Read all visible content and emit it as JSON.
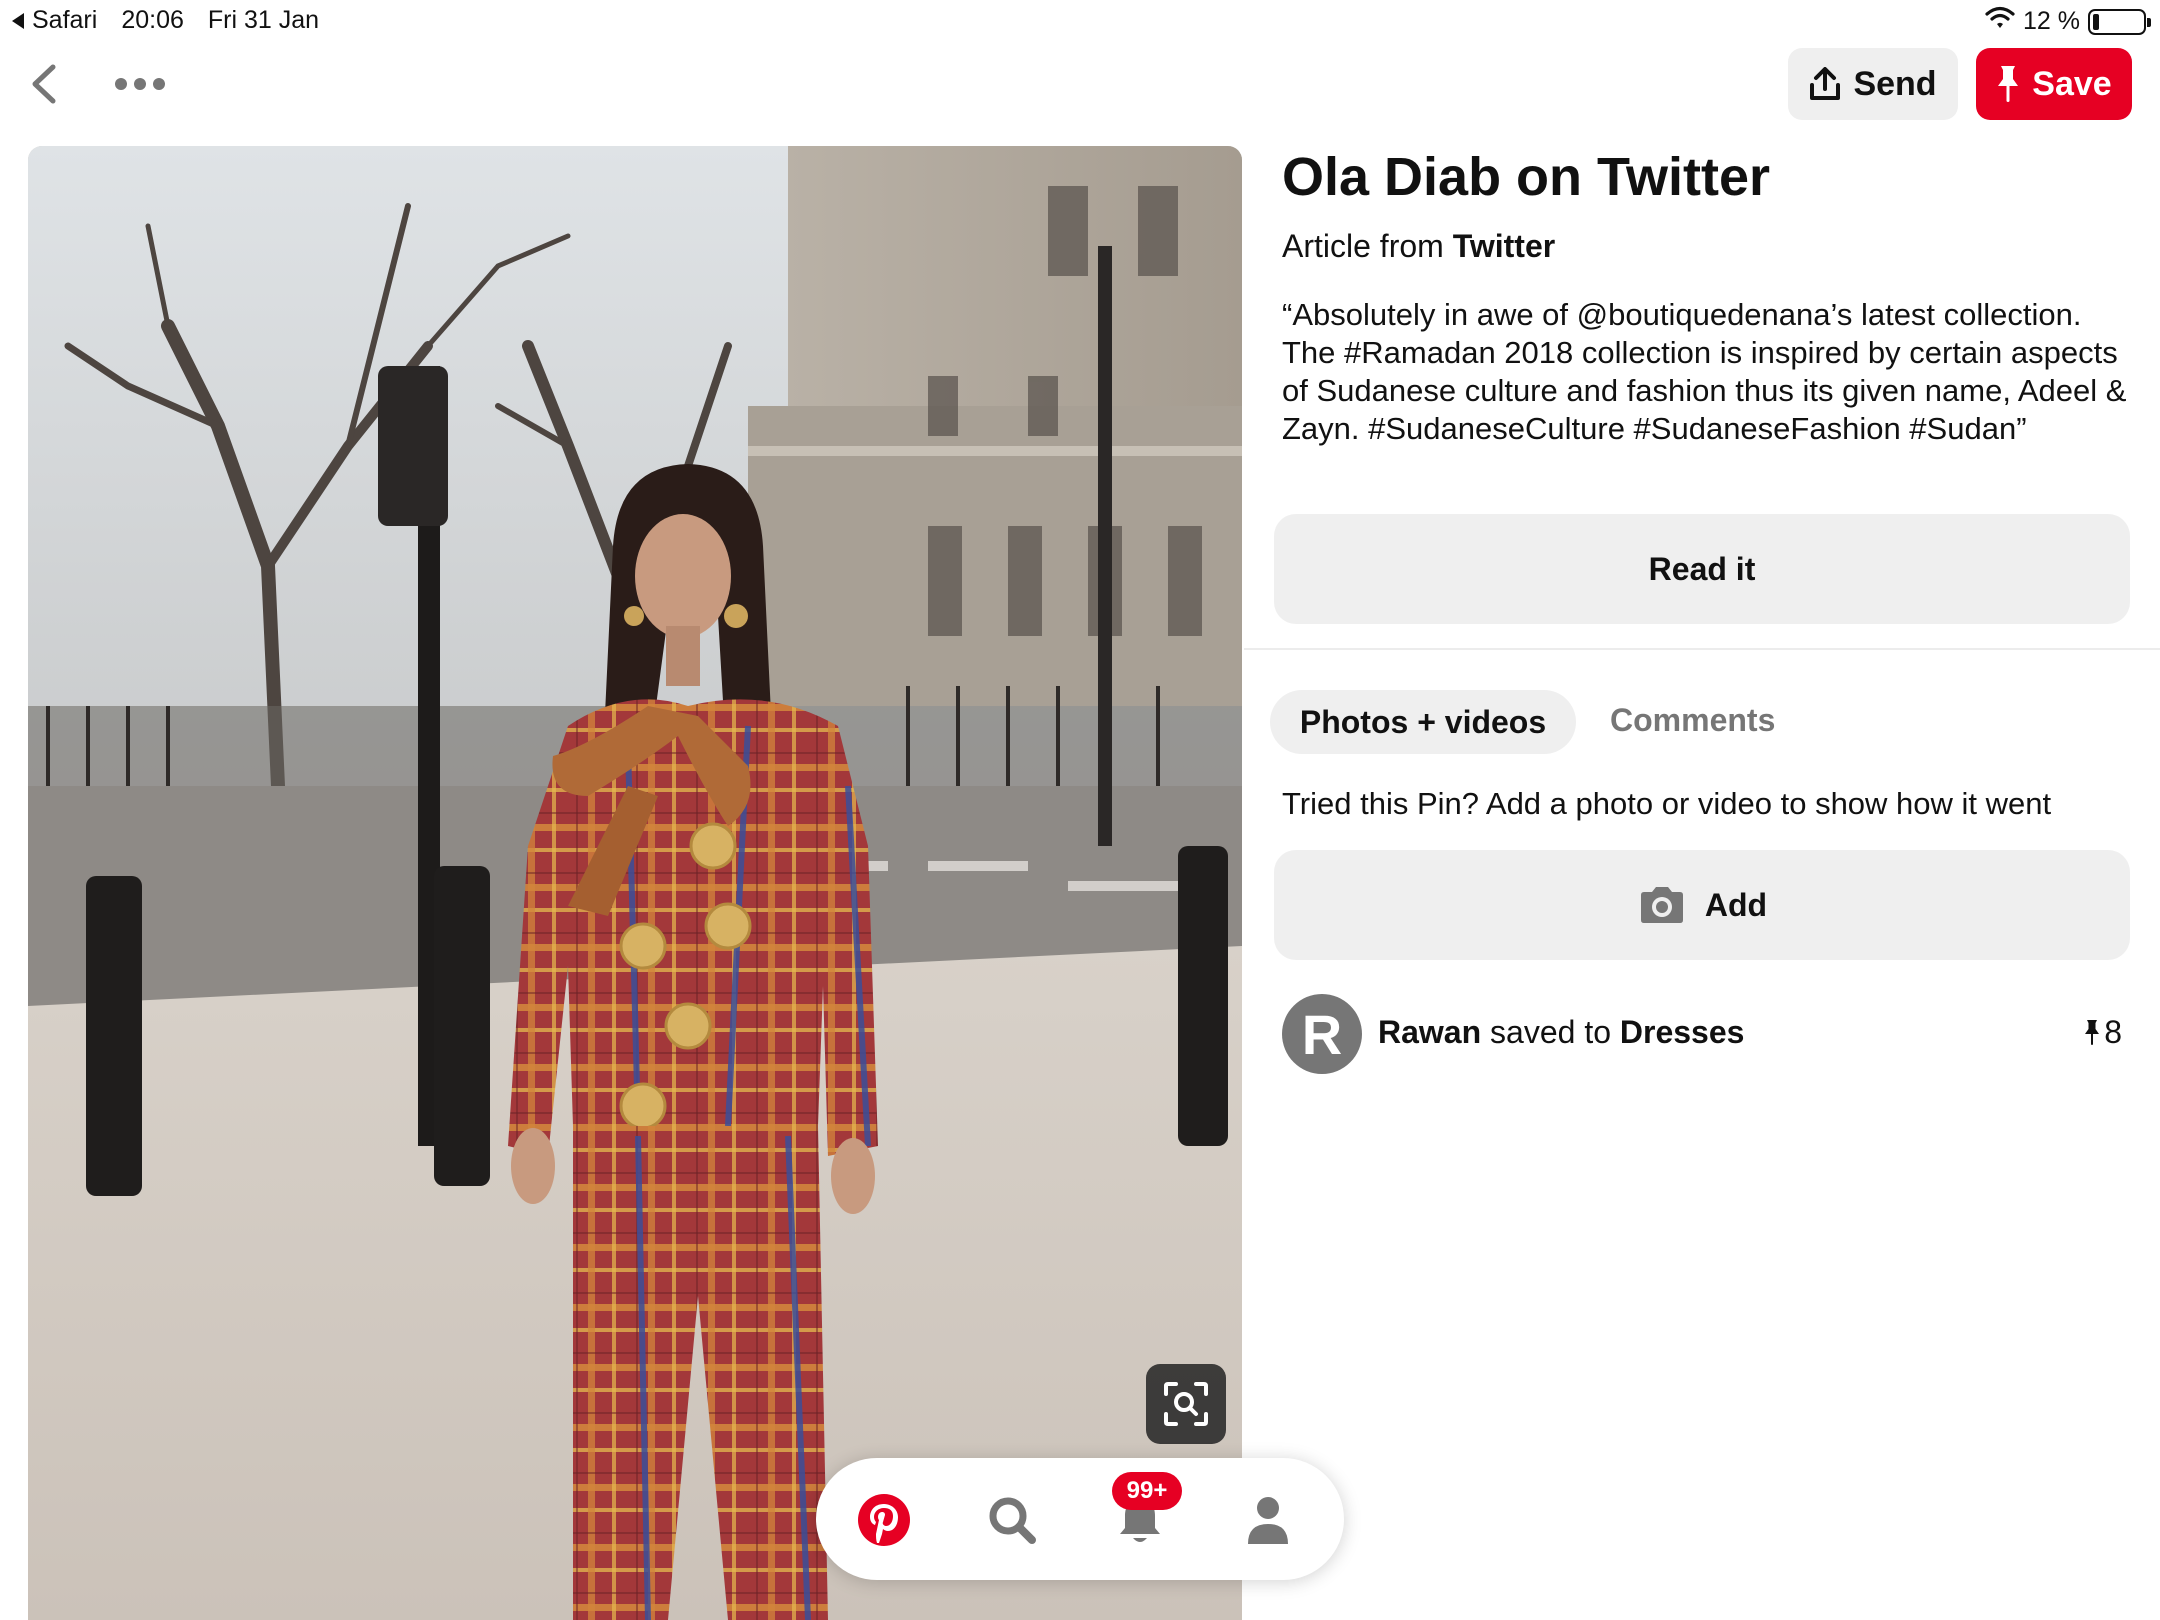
{
  "status_bar": {
    "back_app": "Safari",
    "time": "20:06",
    "date": "Fri 31 Jan",
    "battery": "12 %",
    "battery_level": 0.12
  },
  "toolbar": {
    "send_label": "Send",
    "save_label": "Save"
  },
  "pin": {
    "title": "Ola Diab on Twitter",
    "source_prefix": "Article from",
    "source_name": "Twitter",
    "description": "“Absolutely in awe of @boutiquedenana’s latest collection. The #Ramadan 2018 collection is inspired by certain aspects of Sudanese culture and fashion thus its given name, Adeel & Zayn. #SudaneseCulture #SudaneseFashion #Sudan”",
    "read_label": "Read it"
  },
  "tabs": {
    "photos_label": "Photos + videos",
    "comments_label": "Comments"
  },
  "tried": {
    "prompt": "Tried this Pin? Add a photo or video to show how it went",
    "add_label": "Add"
  },
  "saved": {
    "avatar_letter": "R",
    "user": "Rawan",
    "middle": "saved to",
    "board": "Dresses",
    "count": "8"
  },
  "bottom_nav": {
    "badge": "99+"
  },
  "colors": {
    "brand_red": "#e60023",
    "button_gray": "#efefef",
    "muted_text": "#767676"
  }
}
